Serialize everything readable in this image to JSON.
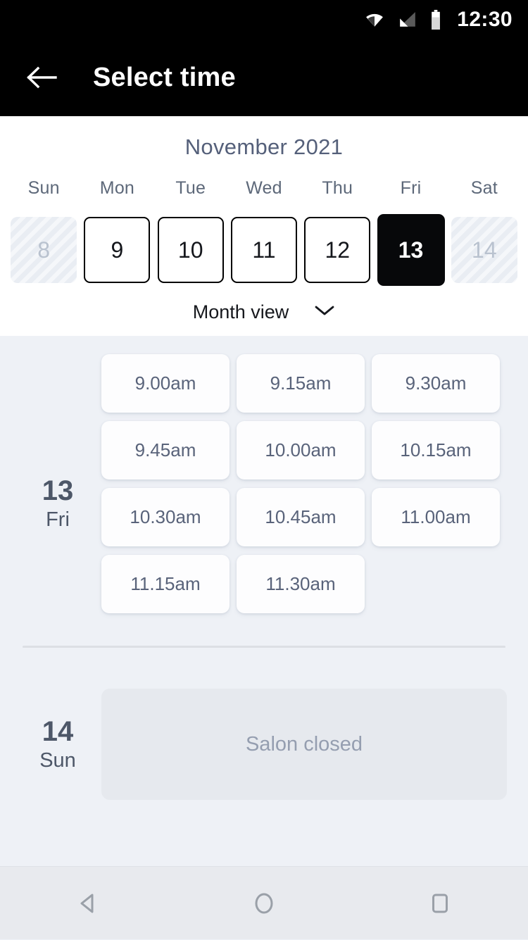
{
  "statusbar": {
    "time": "12:30",
    "icons": [
      "wifi-icon",
      "signal-icon",
      "battery-icon"
    ]
  },
  "appbar": {
    "back_icon": "arrow-left-icon",
    "title": "Select time"
  },
  "calendar": {
    "month_title": "November 2021",
    "weekdays": [
      "Sun",
      "Mon",
      "Tue",
      "Wed",
      "Thu",
      "Fri",
      "Sat"
    ],
    "days": [
      {
        "num": "8",
        "state": "disabled"
      },
      {
        "num": "9",
        "state": "available"
      },
      {
        "num": "10",
        "state": "available"
      },
      {
        "num": "11",
        "state": "available"
      },
      {
        "num": "12",
        "state": "available"
      },
      {
        "num": "13",
        "state": "selected"
      },
      {
        "num": "14",
        "state": "disabled"
      }
    ],
    "view_toggle": {
      "label": "Month view",
      "icon": "chevron-down-icon"
    }
  },
  "schedule": [
    {
      "day_num": "13",
      "day_dow": "Fri",
      "slots": [
        "9.00am",
        "9.15am",
        "9.30am",
        "9.45am",
        "10.00am",
        "10.15am",
        "10.30am",
        "10.45am",
        "11.00am",
        "11.15am",
        "11.30am"
      ]
    },
    {
      "day_num": "14",
      "day_dow": "Sun",
      "closed_message": "Salon closed"
    }
  ],
  "navbar": {
    "back": "nav-back-icon",
    "home": "nav-home-icon",
    "recents": "nav-recents-icon"
  },
  "colors": {
    "appbar_bg": "#000000",
    "page_bg": "#eef1f6",
    "card_bg": "#fdfdfe",
    "selected_day_bg": "#07080a",
    "text_slate": "#55607a",
    "muted": "#959eb0"
  }
}
